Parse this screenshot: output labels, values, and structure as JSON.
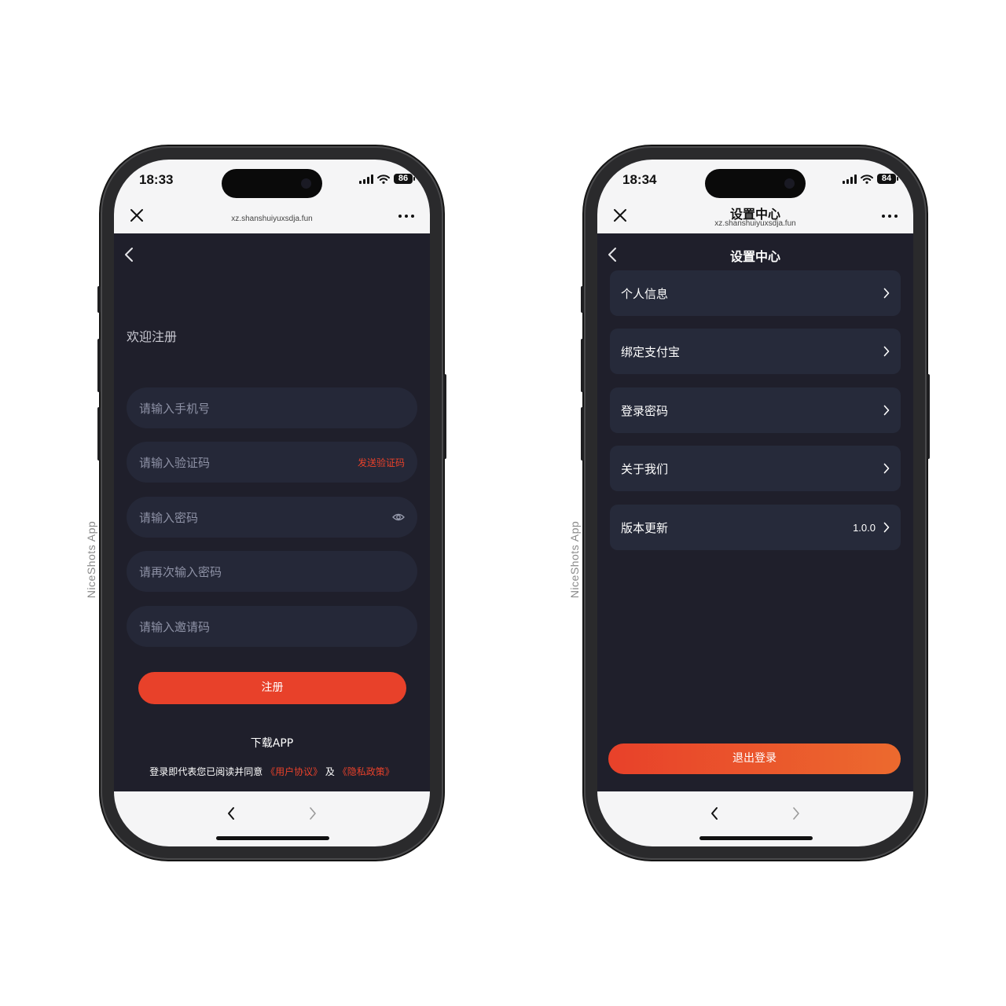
{
  "watermark": "NiceShots App",
  "register_phone": {
    "status": {
      "time": "18:33",
      "battery": "86"
    },
    "browser": {
      "url": "xz.shanshuiyuxsdja.fun"
    },
    "welcome_title": "欢迎注册",
    "fields": [
      {
        "placeholder": "请输入手机号"
      },
      {
        "placeholder": "请输入验证码",
        "action": "发送验证码"
      },
      {
        "placeholder": "请输入密码",
        "icon": "eye-icon"
      },
      {
        "placeholder": "请再次输入密码"
      },
      {
        "placeholder": "请输入邀请码"
      }
    ],
    "register_button": "注册",
    "download_app": "下载APP",
    "agreement": {
      "prefix": "登录即代表您已阅读并同意",
      "user_agreement": "《用户协议》",
      "conjunction": "及",
      "privacy_policy": "《隐私政策》"
    }
  },
  "settings_phone": {
    "status": {
      "time": "18:34",
      "battery": "84"
    },
    "browser": {
      "title": "设置中心",
      "url": "xz.shanshuiyuxsdja.fun"
    },
    "page_title": "设置中心",
    "menu_items": [
      {
        "label": "个人信息"
      },
      {
        "label": "绑定支付宝"
      },
      {
        "label": "登录密码"
      },
      {
        "label": "关于我们"
      },
      {
        "label": "版本更新",
        "value": "1.0.0"
      }
    ],
    "logout_button": "退出登录"
  },
  "colors": {
    "accent": "#e8412a",
    "screen_bg": "#1f1f2b",
    "field_bg": "#252838",
    "menu_bg": "#262a3a"
  }
}
